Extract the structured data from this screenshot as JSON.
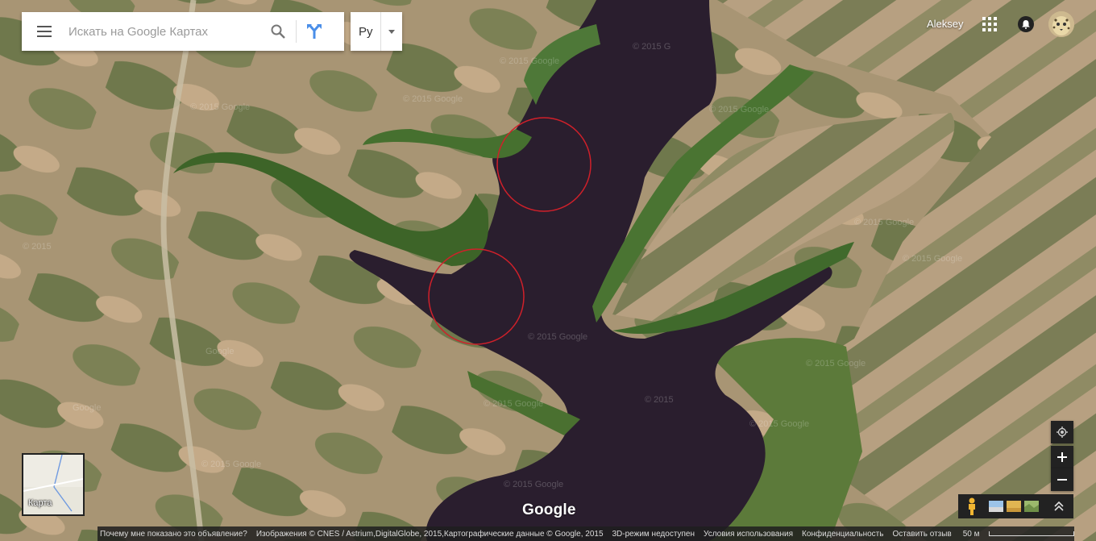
{
  "search": {
    "placeholder": "Искать на Google Картах"
  },
  "language": {
    "selected": "Ру"
  },
  "user": {
    "name": "Aleksey"
  },
  "minimap": {
    "label": "Карта"
  },
  "map": {
    "logo": "Google",
    "watermarks": [
      "© 2015 Google",
      "© 2015 G",
      "© 2015 Google",
      "© 2015 Google",
      "© 2015",
      "© 2015 Google",
      "Google",
      "© 2015 Google",
      "© 2015",
      "© 2015 Google",
      "Google",
      "© 2015 Google",
      "© 2015 Google",
      "© 2015 Google",
      "© 2015 Google",
      "© 2015 Google",
      "© 2015 Google"
    ]
  },
  "footer": {
    "why_ad": "Почему мне показано это объявление?",
    "imagery": "Изображения © CNES / Astrium,DigitalGlobe, 2015,Картографические данные © Google, 2015",
    "mode_3d": "3D-режим недоступен",
    "terms": "Условия использования",
    "privacy": "Конфиденциальность",
    "feedback": "Оставить отзыв",
    "scale": "50 м"
  },
  "colors": {
    "water": "#2a1e2e",
    "field_light": "#b9a184",
    "field_dark": "#6f7a4c",
    "trees": "#3f6a2a",
    "marker_circle": "#d0202a"
  },
  "icons": {
    "menu": "hamburger-icon",
    "search": "search-icon",
    "directions": "directions-icon",
    "apps": "apps-grid-icon",
    "notifications": "bell-icon",
    "location": "my-location-icon",
    "pegman": "pegman-icon"
  }
}
